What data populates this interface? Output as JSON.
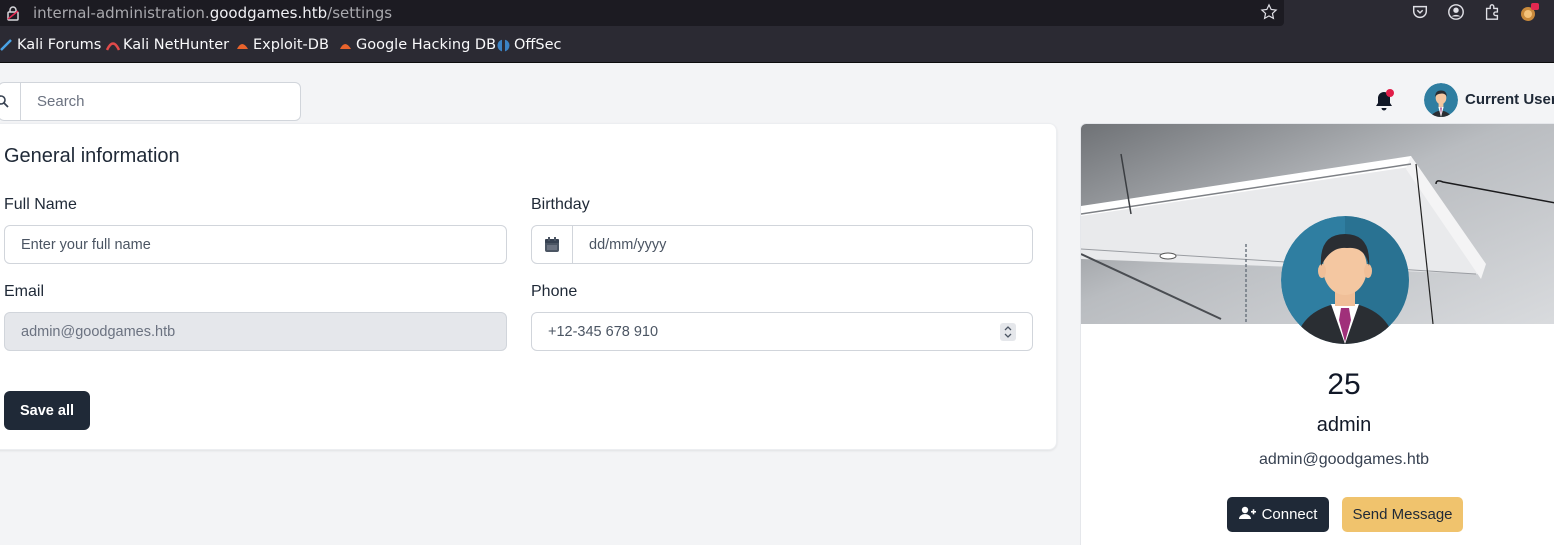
{
  "browser": {
    "url_prefix": "internal-administration.",
    "url_host": "goodgames.htb",
    "url_path": "/settings",
    "bookmarks": [
      {
        "label": "Kali Forums",
        "icon": "kali-icon"
      },
      {
        "label": "Kali NetHunter",
        "icon": "nethunter-icon"
      },
      {
        "label": "Exploit-DB",
        "icon": "exploitdb-icon"
      },
      {
        "label": "Google Hacking DB",
        "icon": "ghdb-icon"
      },
      {
        "label": "OffSec",
        "icon": "offsec-icon"
      }
    ]
  },
  "header": {
    "search_placeholder": "Search",
    "current_user_label": "Current User:",
    "has_notification": true
  },
  "general": {
    "title": "General information",
    "full_name_label": "Full Name",
    "full_name_placeholder": "Enter your full name",
    "birthday_label": "Birthday",
    "birthday_placeholder": "dd/mm/yyyy",
    "email_label": "Email",
    "email_value": "admin@goodgames.htb",
    "phone_label": "Phone",
    "phone_placeholder": "+12-345 678 910",
    "save_label": "Save all"
  },
  "profile": {
    "count": "25",
    "name": "admin",
    "email": "admin@goodgames.htb",
    "connect_label": "Connect",
    "message_label": "Send Message"
  },
  "colors": {
    "primary_dark": "#1f2937",
    "accent_yellow": "#f0c36d",
    "notification_red": "#e11d48"
  }
}
